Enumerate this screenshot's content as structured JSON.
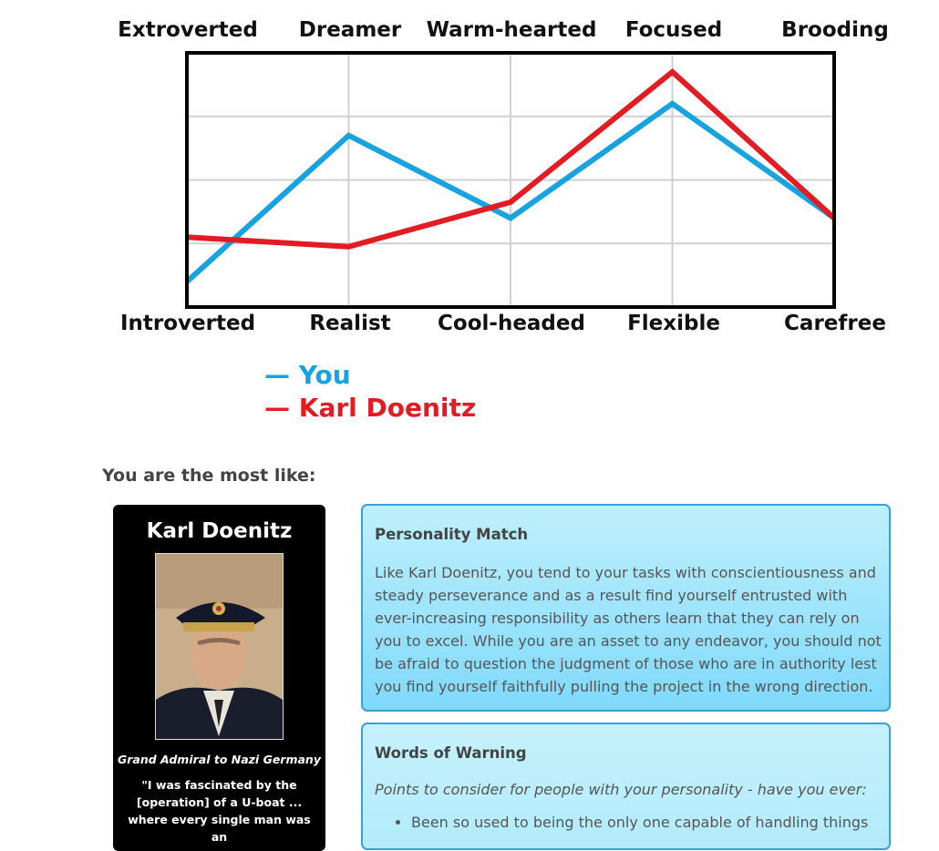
{
  "chart": {
    "top_labels": [
      "Extroverted",
      "Dreamer",
      "Warm-hearted",
      "Focused",
      "Brooding"
    ],
    "bottom_labels": [
      "Introverted",
      "Realist",
      "Cool-headed",
      "Flexible",
      "Carefree"
    ],
    "legend_you": "— You",
    "legend_match": "— Karl Doenitz",
    "colors": {
      "you": "#16a3e0",
      "match": "#e31b23",
      "grid": "#d0d0d0",
      "frame": "#000000"
    }
  },
  "chart_data": {
    "type": "line",
    "categories": [
      "Extroverted / Introverted",
      "Dreamer / Realist",
      "Warm-hearted / Cool-headed",
      "Focused / Flexible",
      "Brooding / Carefree"
    ],
    "ylim": [
      0,
      4
    ],
    "grid": true,
    "series": [
      {
        "name": "You",
        "values": [
          0.4,
          2.7,
          1.4,
          3.2,
          1.4
        ]
      },
      {
        "name": "Karl Doenitz",
        "values": [
          1.1,
          0.95,
          1.65,
          3.7,
          1.4
        ]
      }
    ]
  },
  "result": {
    "most_like_label": "You are the most like:",
    "card": {
      "name": "Karl Doenitz",
      "title": "Grand Admiral to Nazi Germany",
      "quote": "\"I was fascinated by the [operation] of a U-boat ... where every single man was an"
    },
    "personality_match": {
      "heading": "Personality Match",
      "text": "Like Karl Doenitz, you tend to your tasks with conscientiousness and steady perseverance and as a result find yourself entrusted with ever-increasing responsibility as others learn that they can rely on you to excel. While you are an asset to any endeavor, you should not be afraid to question the judgment of those who are in authority lest you find yourself faithfully pulling the project in the wrong direction."
    },
    "words_of_warning": {
      "heading": "Words of Warning",
      "intro": "Points to consider for people with your personality - have you ever:",
      "items": [
        "Been so used to being the only one capable of handling things"
      ]
    }
  }
}
